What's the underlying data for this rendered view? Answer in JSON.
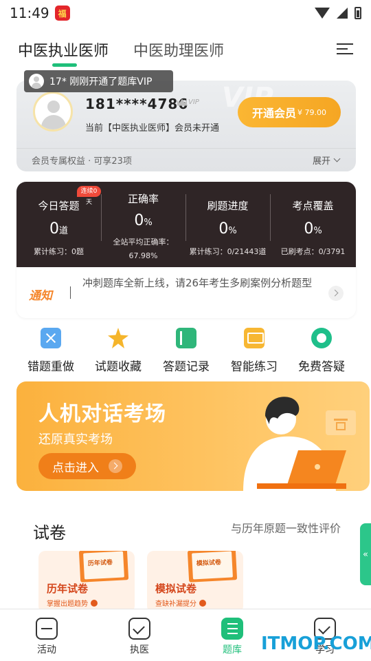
{
  "status_bar": {
    "time": "11:49"
  },
  "header": {
    "tabs": [
      {
        "label": "中医执业医师",
        "active": true
      },
      {
        "label": "中医助理医师",
        "active": false
      }
    ]
  },
  "toast": {
    "text": "17* 刚刚开通了题库VIP"
  },
  "member": {
    "watermark": "VIP",
    "phone": "181****4786",
    "vip_tag": "VIP",
    "status": "当前【中医执业医师】会员未开通",
    "open_button": {
      "label": "开通会员",
      "price": "¥ 79.00"
    },
    "benefits": "会员专属权益 · 可享23项",
    "expand": "展开"
  },
  "stats": {
    "items": [
      {
        "title": "今日答题",
        "value": "0",
        "unit": "道",
        "sub": "累计练习：0题",
        "badge": "连续0天"
      },
      {
        "title": "正确率",
        "value": "0",
        "unit": "%",
        "sub": "全站平均正确率：67.98%"
      },
      {
        "title": "刷题进度",
        "value": "0",
        "unit": "%",
        "sub": "累计练习：0/21443道"
      },
      {
        "title": "考点覆盖",
        "value": "0",
        "unit": "%",
        "sub": "已刷考点：0/3791"
      }
    ],
    "notice": {
      "logo": "通知",
      "text": "冲刺题库全新上线，请26年考生多刷案例分析题型"
    }
  },
  "features": [
    {
      "label": "错题重做",
      "icon": "wrong-questions-icon"
    },
    {
      "label": "试题收藏",
      "icon": "star-icon"
    },
    {
      "label": "答题记录",
      "icon": "record-book-icon"
    },
    {
      "label": "智能练习",
      "icon": "smart-practice-icon"
    },
    {
      "label": "免费答疑",
      "icon": "chat-icon"
    }
  ],
  "promo": {
    "title": "人机对话考场",
    "subtitle": "还原真实考场",
    "button": "点击进入"
  },
  "papers": {
    "title": "试卷",
    "subtitle": "与历年原题一致性评价",
    "tiles": [
      {
        "book_label": "历年试卷",
        "name": "历年试卷",
        "desc": "掌握出题趋势"
      },
      {
        "book_label": "模拟试卷",
        "name": "模拟试卷",
        "desc": "查缺补漏提分"
      }
    ]
  },
  "side_tab": {
    "label": "«"
  },
  "bottom_nav": [
    {
      "label": "活动",
      "active": false
    },
    {
      "label": "执医",
      "active": false
    },
    {
      "label": "题库",
      "active": true
    },
    {
      "label": "学习",
      "active": false
    }
  ],
  "watermark": "ITMOP.COM",
  "colors": {
    "accent_green": "#1fbf7a",
    "vip_orange": "#f5a623",
    "dark_panel": "#2f2526"
  }
}
